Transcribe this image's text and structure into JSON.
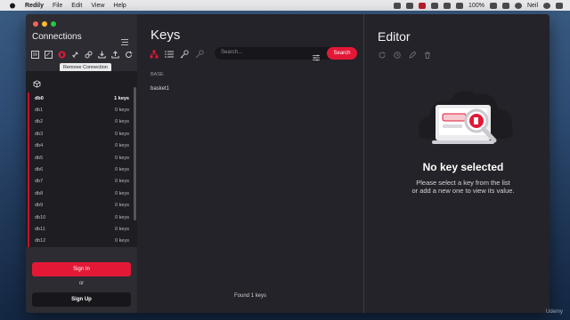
{
  "menubar": {
    "app_name": "Redily",
    "menus": [
      "File",
      "Edit",
      "View",
      "Help"
    ],
    "battery": "100%",
    "user": "Neil"
  },
  "sidebar": {
    "title": "Connections",
    "tooltip": "Remove Connection",
    "databases": [
      {
        "name": "db0",
        "count": "1 keys",
        "active": true
      },
      {
        "name": "db1",
        "count": "0 keys"
      },
      {
        "name": "db2",
        "count": "0 keys"
      },
      {
        "name": "db3",
        "count": "0 keys"
      },
      {
        "name": "db4",
        "count": "0 keys"
      },
      {
        "name": "db5",
        "count": "0 keys"
      },
      {
        "name": "db6",
        "count": "0 keys"
      },
      {
        "name": "db7",
        "count": "0 keys"
      },
      {
        "name": "db8",
        "count": "0 keys"
      },
      {
        "name": "db9",
        "count": "0 keys"
      },
      {
        "name": "db10",
        "count": "0 keys"
      },
      {
        "name": "db11",
        "count": "0 keys"
      },
      {
        "name": "db12",
        "count": "0 keys"
      }
    ],
    "signin_label": "Sign In",
    "or_label": "or",
    "signup_label": "Sign Up"
  },
  "keys": {
    "title": "Keys",
    "search_placeholder": "Search...",
    "search_button": "Search",
    "section_label": "BASE",
    "items": [
      "basket1"
    ],
    "footer": "Found 1 keys"
  },
  "editor": {
    "title": "Editor",
    "empty_title": "No key selected",
    "empty_line1": "Please select a key from the list",
    "empty_line2": "or add a new one to view its value."
  },
  "watermark": "Udemy",
  "colors": {
    "accent": "#e31837",
    "window_bg": "#222228",
    "sidebar_bg": "#2c2c32"
  },
  "icons": {
    "sidebar_tools": [
      "add-connection-icon",
      "edit-connection-icon",
      "remove-connection-icon",
      "link-icon",
      "unlink-icon",
      "import-icon",
      "export-icon",
      "refresh-icon"
    ],
    "keys_tools": [
      "tree-view-icon",
      "list-view-icon",
      "add-key-icon",
      "delete-key-icon"
    ],
    "editor_tools": [
      "reload-icon",
      "ttl-icon",
      "rename-icon",
      "trash-icon"
    ]
  }
}
